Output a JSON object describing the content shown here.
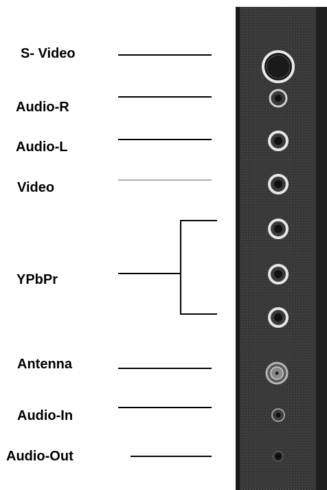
{
  "connectors": [
    {
      "id": "s-video",
      "label": "S- Video",
      "icon": "s-video-port-icon"
    },
    {
      "id": "audio-r",
      "label": "Audio-R",
      "icon": "rca-jack-icon"
    },
    {
      "id": "audio-l",
      "label": "Audio-L",
      "icon": "rca-jack-icon"
    },
    {
      "id": "video",
      "label": "Video",
      "icon": "rca-jack-icon"
    },
    {
      "id": "ypbpr",
      "label": "YPbPr",
      "icon": "component-jack-group-icon"
    },
    {
      "id": "antenna",
      "label": "Antenna",
      "icon": "coax-connector-icon"
    },
    {
      "id": "audio-in",
      "label": "Audio-In",
      "icon": "mini-jack-icon"
    },
    {
      "id": "audio-out",
      "label": "Audio-Out",
      "icon": "mini-jack-icon"
    }
  ],
  "colors": {
    "panel": "#2c2c2c",
    "panel_edge": "#111111",
    "jack_ring": "#e6e6e6",
    "text": "#000000",
    "leader_line": "#000000",
    "leader_line_faint": "#7a7a7a"
  }
}
